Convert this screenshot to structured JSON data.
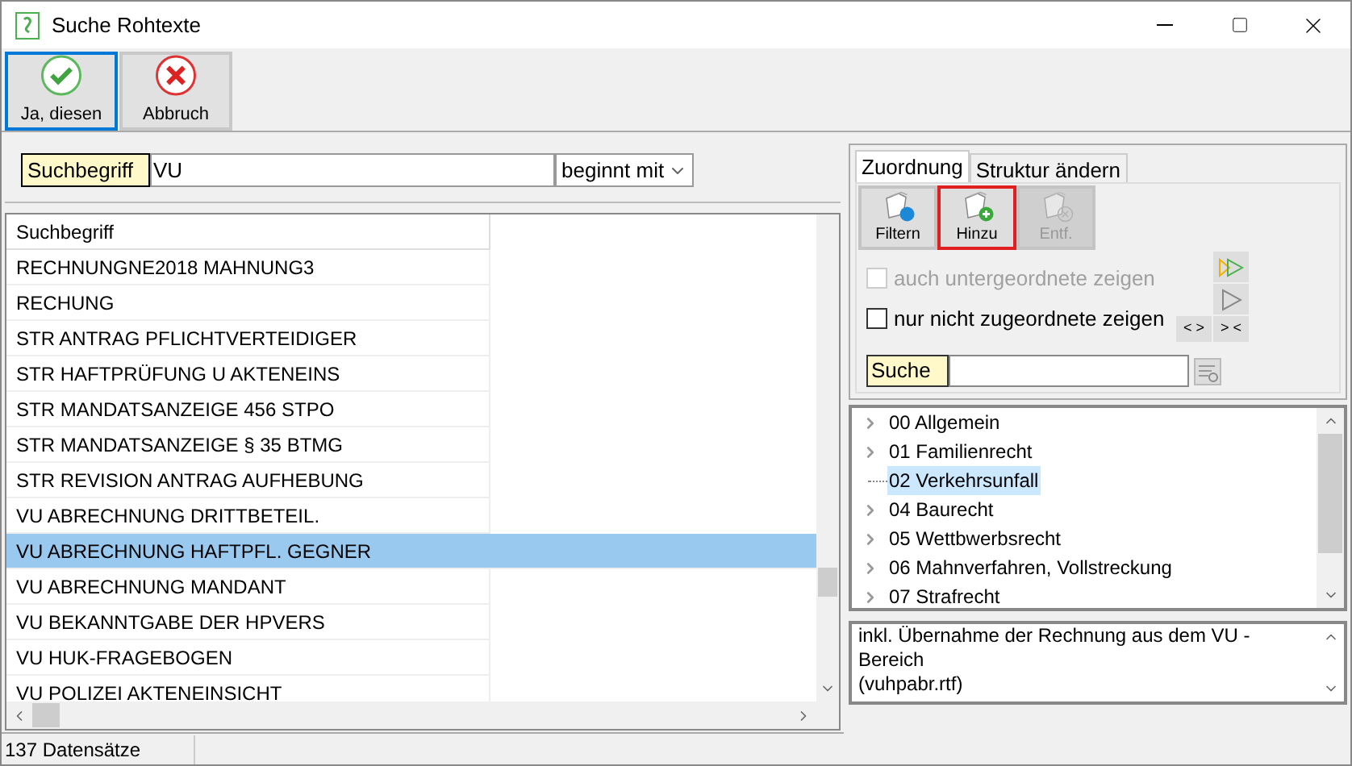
{
  "window": {
    "title": "Suche Rohtexte"
  },
  "toolbar": [
    {
      "label": "Ja, diesen",
      "kind": "ok",
      "focused": true
    },
    {
      "label": "Abbruch",
      "kind": "cancel",
      "focused": false
    }
  ],
  "search": {
    "label": "Suchbegriff",
    "value": "VU",
    "mode": "beginnt mit"
  },
  "table": {
    "columns": [
      "Suchbegriff"
    ],
    "rows": [
      {
        "text": "RECHNUNGNE2018 MAHNUNG3",
        "selected": false
      },
      {
        "text": "RECHUNG",
        "selected": false
      },
      {
        "text": "STR ANTRAG PFLICHTVERTEIDIGER",
        "selected": false
      },
      {
        "text": "STR HAFTPRÜFUNG U AKTENEINS",
        "selected": false
      },
      {
        "text": "STR MANDATSANZEIGE 456 STPO",
        "selected": false
      },
      {
        "text": "STR MANDATSANZEIGE § 35 BTMG",
        "selected": false
      },
      {
        "text": "STR REVISION ANTRAG AUFHEBUNG",
        "selected": false
      },
      {
        "text": "VU ABRECHNUNG DRITTBETEIL.",
        "selected": false
      },
      {
        "text": "VU ABRECHNUNG HAFTPFL. GEGNER",
        "selected": true
      },
      {
        "text": "VU ABRECHNUNG MANDANT",
        "selected": false
      },
      {
        "text": "VU BEKANNTGABE DER HPVERS",
        "selected": false
      },
      {
        "text": "VU HUK-FRAGEBOGEN",
        "selected": false
      },
      {
        "text": "VU POLIZEI AKTENEINSICHT",
        "selected": false
      }
    ]
  },
  "status_bar": "137 Datensätze",
  "tabs": [
    {
      "label": "Zuordnung",
      "selected": true
    },
    {
      "label": "Struktur ändern",
      "selected": false
    }
  ],
  "assign_buttons": [
    {
      "label": "Filtern",
      "kind": "filter",
      "disabled": false,
      "highlighted": false
    },
    {
      "label": "Hinzu",
      "kind": "add",
      "disabled": false,
      "highlighted": true
    },
    {
      "label": "Entf.",
      "kind": "remove",
      "disabled": true,
      "highlighted": false
    }
  ],
  "options": [
    {
      "label": "auch untergeordnete zeigen",
      "checked": false,
      "disabled": true
    },
    {
      "label": "nur nicht zugeordnete zeigen",
      "checked": false,
      "disabled": false
    }
  ],
  "small_buttons": [
    "< >",
    "> <"
  ],
  "tree_search": {
    "label": "Suche"
  },
  "tree": [
    {
      "label": "00 Allgemein",
      "expandable": true,
      "selected": false
    },
    {
      "label": "01 Familienrecht",
      "expandable": true,
      "selected": false
    },
    {
      "label": "02 Verkehrsunfall",
      "expandable": false,
      "selected": true
    },
    {
      "label": "04 Baurecht",
      "expandable": true,
      "selected": false
    },
    {
      "label": "05 Wettbwerbsrecht",
      "expandable": true,
      "selected": false
    },
    {
      "label": "06 Mahnverfahren, Vollstreckung",
      "expandable": true,
      "selected": false
    },
    {
      "label": "07 Strafrecht",
      "expandable": true,
      "selected": false
    }
  ],
  "description": [
    "inkl. Übernahme der Rechnung aus dem VU - Bereich",
    "(vuhpabr.rtf)"
  ]
}
